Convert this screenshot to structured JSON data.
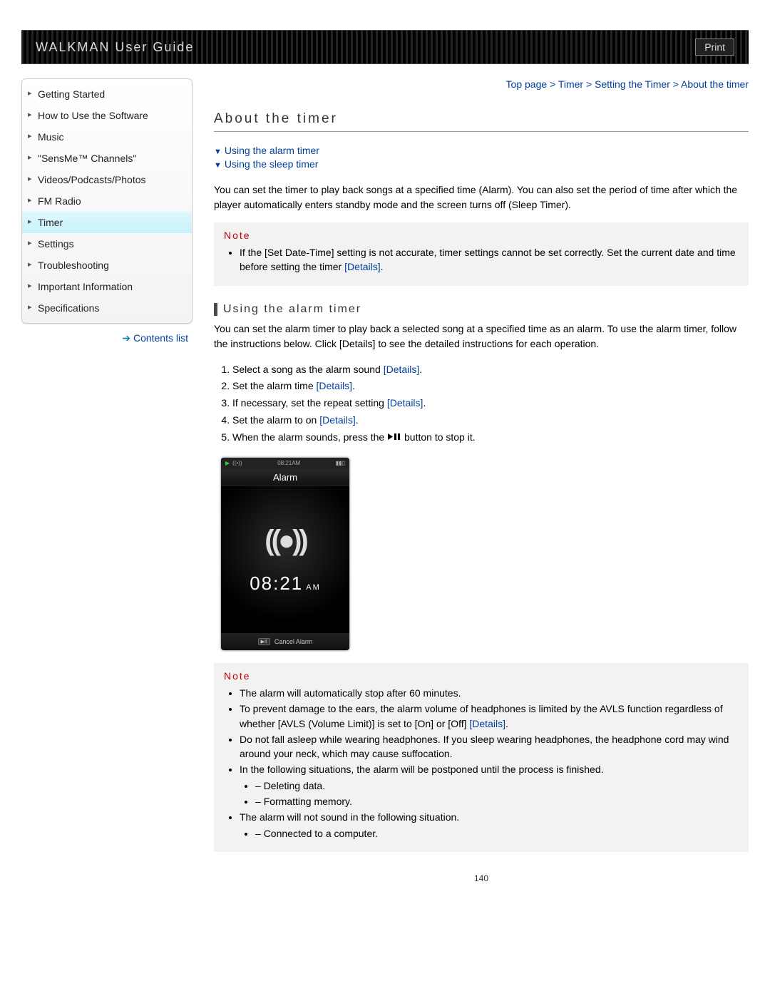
{
  "header": {
    "title": "WALKMAN User Guide",
    "print": "Print"
  },
  "sidebar": {
    "items": [
      {
        "label": "Getting Started"
      },
      {
        "label": "How to Use the Software"
      },
      {
        "label": "Music"
      },
      {
        "label": "\"SensMe™ Channels\""
      },
      {
        "label": "Videos/Podcasts/Photos"
      },
      {
        "label": "FM Radio"
      },
      {
        "label": "Timer"
      },
      {
        "label": "Settings"
      },
      {
        "label": "Troubleshooting"
      },
      {
        "label": "Important Information"
      },
      {
        "label": "Specifications"
      }
    ],
    "contents_link": "Contents list"
  },
  "breadcrumb": "Top page > Timer > Setting the Timer > About the timer",
  "page_title": "About the timer",
  "anchors": {
    "alarm": "Using the alarm timer",
    "sleep": "Using the sleep timer"
  },
  "intro": "You can set the timer to play back songs at a specified time (Alarm). You can also set the period of time after which the player automatically enters standby mode and the screen turns off (Sleep Timer).",
  "note1": {
    "label": "Note",
    "item": "If the [Set Date-Time] setting is not accurate, timer settings cannot be set correctly. Set the current date and time before setting the timer ",
    "details": "[Details]",
    "period": "."
  },
  "section1": {
    "title": "Using the alarm timer",
    "intro": "You can set the alarm timer to play back a selected song at a specified time as an alarm. To use the alarm timer, follow the instructions below. Click [Details] to see the detailed instructions for each operation.",
    "steps": {
      "s1a": "Select a song as the alarm sound ",
      "s1d": "[Details]",
      "s1p": ".",
      "s2a": "Set the alarm time ",
      "s2d": "[Details]",
      "s2p": ".",
      "s3a": "If necessary, set the repeat setting ",
      "s3d": "[Details]",
      "s3p": ".",
      "s4a": "Set the alarm to on ",
      "s4d": "[Details]",
      "s4p": ".",
      "s5a": "When the alarm sounds, press the ",
      "s5b": " button to stop it."
    }
  },
  "device": {
    "status_time": "08:21AM",
    "title": "Alarm",
    "time": "08:21",
    "ampm": "AM",
    "footer_btn": "▶II",
    "footer_text": "Cancel Alarm"
  },
  "note2": {
    "label": "Note",
    "i1": "The alarm will automatically stop after 60 minutes.",
    "i2a": "To prevent damage to the ears, the alarm volume of headphones is limited by the AVLS function regardless of whether [AVLS (Volume Limit)] is set to [On] or [Off] ",
    "i2d": "[Details]",
    "i2p": ".",
    "i3": "Do not fall asleep while wearing headphones. If you sleep wearing headphones, the headphone cord may wind around your neck, which may cause suffocation.",
    "i4": "In the following situations, the alarm will be postponed until the process is finished.",
    "i4a": "Deleting data.",
    "i4b": "Formatting memory.",
    "i5": "The alarm will not sound in the following situation.",
    "i5a": "Connected to a computer."
  },
  "page_number": "140"
}
